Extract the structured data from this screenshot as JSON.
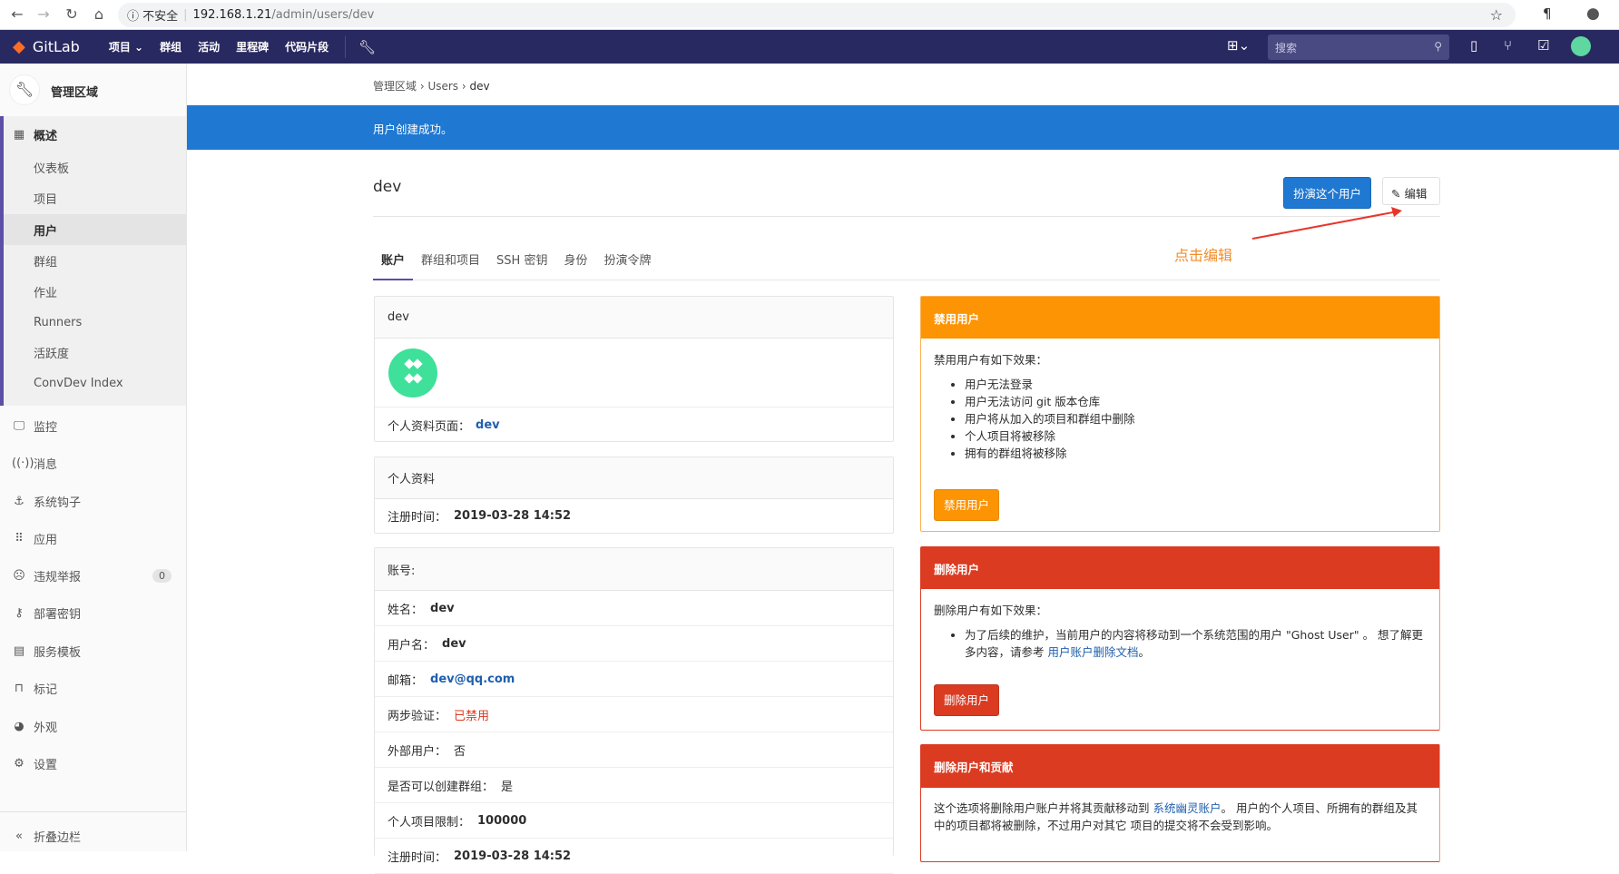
{
  "browser": {
    "security": "不安全",
    "url_host": "192.168.1.21",
    "url_path": "/admin/users/dev"
  },
  "topnav": {
    "brand": "GitLab",
    "items": [
      "项目",
      "群组",
      "活动",
      "里程碑",
      "代码片段"
    ],
    "search_placeholder": "搜索"
  },
  "sidebar": {
    "title": "管理区域",
    "overview": "概述",
    "sub": [
      "仪表板",
      "项目",
      "用户",
      "群组",
      "作业",
      "Runners",
      "活跃度",
      "ConvDev Index"
    ],
    "items": [
      {
        "label": "监控",
        "icon": "monitor-icon"
      },
      {
        "label": "消息",
        "icon": "broadcast-icon"
      },
      {
        "label": "系统钩子",
        "icon": "anchor-icon"
      },
      {
        "label": "应用",
        "icon": "apps-icon"
      },
      {
        "label": "违规举报",
        "icon": "abuse-icon",
        "badge": "0"
      },
      {
        "label": "部署密钥",
        "icon": "key-icon"
      },
      {
        "label": "服务模板",
        "icon": "template-icon"
      },
      {
        "label": "标记",
        "icon": "labels-icon"
      },
      {
        "label": "外观",
        "icon": "palette-icon"
      },
      {
        "label": "设置",
        "icon": "gear-icon"
      }
    ],
    "collapse": "折叠边栏"
  },
  "breadcrumb": [
    "管理区域",
    "Users",
    "dev"
  ],
  "flash": "用户创建成功。",
  "page": {
    "title": "dev",
    "impersonate": "扮演这个用户",
    "edit": "编辑",
    "annotation": "点击编辑"
  },
  "tabs": [
    "账户",
    "群组和项目",
    "SSH 密钥",
    "身份",
    "扮演令牌"
  ],
  "profile": {
    "name": "dev",
    "profile_label": "个人资料页面：",
    "profile_link": "dev"
  },
  "personal": {
    "title": "个人资料",
    "reg_label": "注册时间：",
    "reg_value": "2019-03-28 14:52"
  },
  "account": {
    "title": "账号:",
    "rows": [
      {
        "label": "姓名：",
        "value": "dev"
      },
      {
        "label": "用户名：",
        "value": "dev"
      },
      {
        "label": "邮箱：",
        "value": "dev@qq.com"
      },
      {
        "label": "两步验证：",
        "value": "已禁用"
      },
      {
        "label": "外部用户：",
        "value": "否"
      },
      {
        "label": "是否可以创建群组：",
        "value": "是"
      },
      {
        "label": "个人项目限制：",
        "value": "100000"
      },
      {
        "label": "注册时间：",
        "value": "2019-03-28 14:52"
      }
    ]
  },
  "block": {
    "title": "禁用用户",
    "intro": "禁用用户有如下效果：",
    "effects": [
      "用户无法登录",
      "用户无法访问 git 版本仓库",
      "用户将从加入的项目和群组中删除",
      "个人项目将被移除",
      "拥有的群组将被移除"
    ],
    "button": "禁用用户"
  },
  "delete": {
    "title": "删除用户",
    "intro": "删除用户有如下效果：",
    "effect": "为了后续的维护，当前用户的内容将移动到一个系统范围的用户 \"Ghost User\" 。 想了解更多内容，请参考 ",
    "link": "用户账户删除文档",
    "tail": "。",
    "button": "删除用户"
  },
  "delete_contrib": {
    "title": "删除用户和贡献",
    "text1": "这个选项将删除用户账户并将其贡献移动到 ",
    "link": "系统幽灵账户",
    "text2": "。 用户的个人项目、所拥有的群组及其中的项目都将被删除，不过用户对其它 项目的提交将不会受到影响。"
  },
  "colors": {
    "nav": "#292961",
    "blue": "#1f78d1",
    "orange": "#fc9403",
    "red": "#db3b21"
  }
}
